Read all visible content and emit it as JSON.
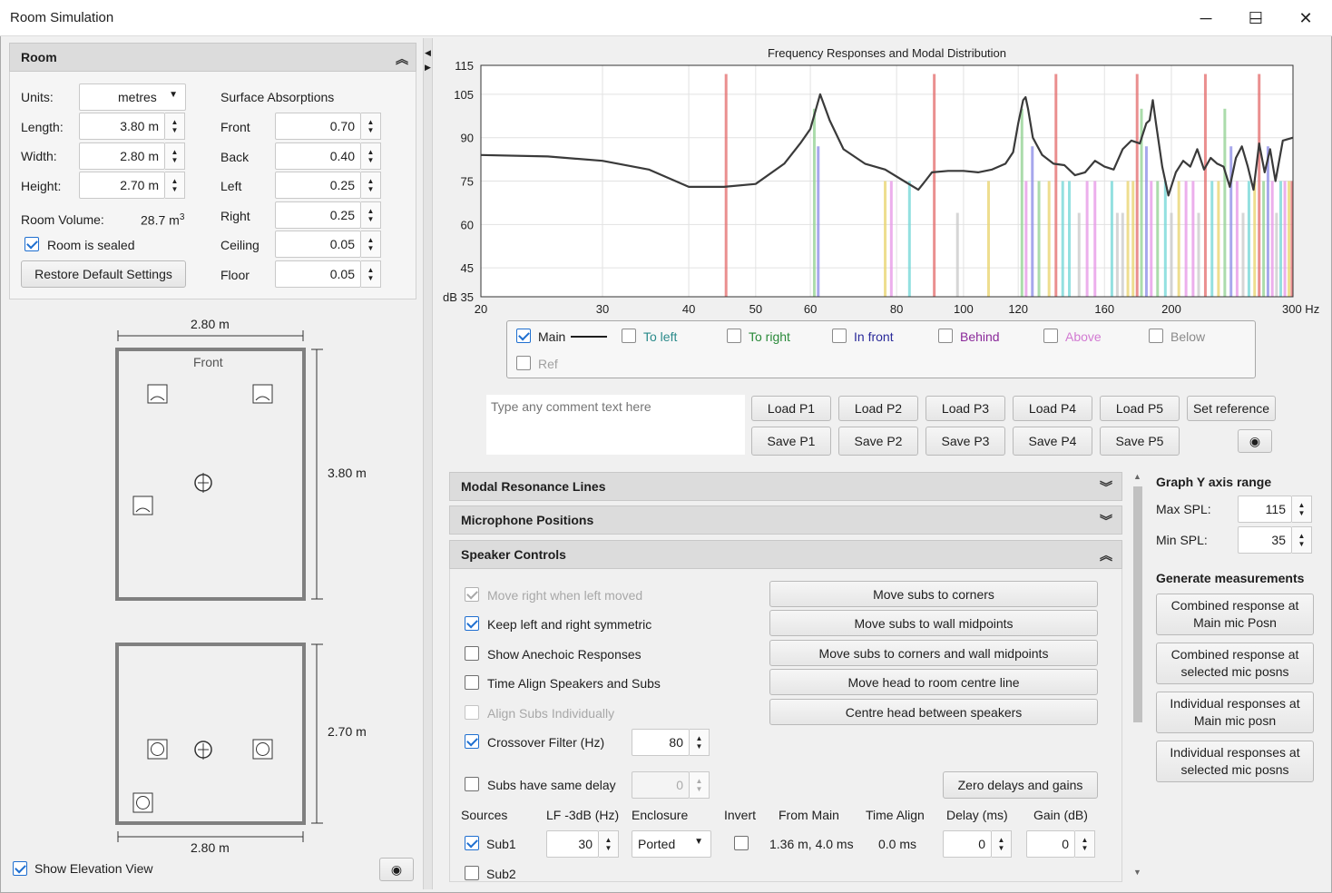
{
  "window": {
    "title": "Room Simulation",
    "minimize": "─",
    "maximize": "☐",
    "close": "✕"
  },
  "room": {
    "header": "Room",
    "units_label": "Units:",
    "units_value": "metres",
    "length_label": "Length:",
    "length_value": "3.80 m",
    "width_label": "Width:",
    "width_value": "2.80 m",
    "height_label": "Height:",
    "height_value": "2.70 m",
    "volume_label": "Room Volume:",
    "volume_value": "28.7 m",
    "volume_sup": "3",
    "sealed_label": "Room is sealed",
    "sealed": true,
    "restore_button": "Restore Default Settings",
    "absorptions_title": "Surface Absorptions",
    "surfaces": [
      {
        "label": "Front",
        "value": "0.70"
      },
      {
        "label": "Back",
        "value": "0.40"
      },
      {
        "label": "Left",
        "value": "0.25"
      },
      {
        "label": "Right",
        "value": "0.25"
      },
      {
        "label": "Ceiling",
        "value": "0.05"
      },
      {
        "label": "Floor",
        "value": "0.05"
      }
    ]
  },
  "plan_view": {
    "width_dim": "2.80 m",
    "length_dim": "3.80 m",
    "front_label": "Front"
  },
  "elevation_view": {
    "height_dim": "2.70 m",
    "width_dim": "2.80 m"
  },
  "show_elevation": {
    "label": "Show Elevation View",
    "checked": true
  },
  "chart_data": {
    "type": "line",
    "title": "Frequency Responses and Modal Distribution",
    "xscale": "log",
    "xlim": [
      20,
      300
    ],
    "ylim": [
      35,
      115
    ],
    "xticks": [
      "20",
      "30",
      "40",
      "50",
      "60",
      "80",
      "100",
      "120",
      "160",
      "200",
      "300 Hz"
    ],
    "xtick_values": [
      20,
      30,
      40,
      50,
      60,
      80,
      100,
      120,
      160,
      200,
      300
    ],
    "yticks": [
      "115",
      "105",
      "90",
      "75",
      "60",
      "45",
      "dB 35"
    ],
    "ytick_values": [
      115,
      105,
      90,
      75,
      60,
      45,
      35
    ],
    "grid": true,
    "series": [
      {
        "name": "Main",
        "color": "#3a3a3a",
        "x": [
          20,
          25,
          30,
          35,
          40,
          45,
          50,
          55,
          58,
          60,
          61,
          62,
          64,
          67,
          72,
          77,
          82,
          86,
          88,
          90,
          95,
          100,
          105,
          110,
          115,
          118,
          120,
          122,
          123,
          124,
          126,
          130,
          135,
          140,
          145,
          150,
          155,
          160,
          165,
          170,
          175,
          180,
          184,
          186,
          188,
          190,
          194,
          198,
          203,
          208,
          213,
          218,
          223,
          228,
          233,
          238,
          243,
          248,
          253,
          258,
          263,
          268,
          273,
          278,
          283,
          290,
          300
        ],
        "y": [
          84,
          83.5,
          82,
          79,
          73,
          73,
          74,
          81,
          88,
          93,
          99,
          105,
          96,
          86,
          81,
          79,
          75,
          72,
          75,
          78,
          78.5,
          78.5,
          78,
          79,
          81,
          85,
          95,
          103,
          104,
          100,
          90,
          84,
          81,
          80.5,
          77,
          78,
          82,
          80,
          79,
          86,
          89,
          88,
          95,
          96,
          103,
          95,
          80,
          70,
          78,
          82,
          80,
          86,
          79,
          83,
          81,
          80,
          73,
          83,
          87,
          80,
          72,
          88,
          78,
          86,
          75,
          89,
          90
        ]
      },
      {
        "name": "To left"
      },
      {
        "name": "To right"
      },
      {
        "name": "In front"
      },
      {
        "name": "Behind"
      },
      {
        "name": "Above"
      },
      {
        "name": "Below"
      },
      {
        "name": "Ref"
      }
    ],
    "modal_lines": [
      {
        "x": 45.3,
        "top": 112,
        "color": "#e36a6a"
      },
      {
        "x": 60.8,
        "top": 100,
        "color": "#8fd08f"
      },
      {
        "x": 61.6,
        "top": 87,
        "color": "#8a8ae6"
      },
      {
        "x": 77,
        "top": 75,
        "color": "#e8d36a"
      },
      {
        "x": 78.6,
        "top": 75,
        "color": "#e594e5"
      },
      {
        "x": 83.5,
        "top": 75,
        "color": "#6fd6d6"
      },
      {
        "x": 90.7,
        "top": 112,
        "color": "#e36a6a"
      },
      {
        "x": 98,
        "top": 64,
        "color": "#c8c8c8"
      },
      {
        "x": 108.7,
        "top": 75,
        "color": "#e8d36a"
      },
      {
        "x": 121.5,
        "top": 100,
        "color": "#8fd08f"
      },
      {
        "x": 123.2,
        "top": 75,
        "color": "#e594e5"
      },
      {
        "x": 125.8,
        "top": 87,
        "color": "#8a8ae6"
      },
      {
        "x": 128.6,
        "top": 75,
        "color": "#8fd08f"
      },
      {
        "x": 133,
        "top": 75,
        "color": "#e8d36a"
      },
      {
        "x": 136.1,
        "top": 112,
        "color": "#e36a6a"
      },
      {
        "x": 139.2,
        "top": 75,
        "color": "#6fd6d6"
      },
      {
        "x": 142.3,
        "top": 75,
        "color": "#6fd6d6"
      },
      {
        "x": 147,
        "top": 64,
        "color": "#c8c8c8"
      },
      {
        "x": 151,
        "top": 75,
        "color": "#e594e5"
      },
      {
        "x": 155,
        "top": 75,
        "color": "#e594e5"
      },
      {
        "x": 164,
        "top": 75,
        "color": "#6fd6d6"
      },
      {
        "x": 167,
        "top": 64,
        "color": "#c8c8c8"
      },
      {
        "x": 170,
        "top": 64,
        "color": "#c8c8c8"
      },
      {
        "x": 173,
        "top": 75,
        "color": "#e8d36a"
      },
      {
        "x": 176,
        "top": 75,
        "color": "#e8d36a"
      },
      {
        "x": 178.4,
        "top": 112,
        "color": "#e36a6a"
      },
      {
        "x": 181,
        "top": 100,
        "color": "#8fd08f"
      },
      {
        "x": 184,
        "top": 87,
        "color": "#8a8ae6"
      },
      {
        "x": 187,
        "top": 75,
        "color": "#e594e5"
      },
      {
        "x": 191,
        "top": 75,
        "color": "#8fd08f"
      },
      {
        "x": 196,
        "top": 75,
        "color": "#6fd6d6"
      },
      {
        "x": 200,
        "top": 64,
        "color": "#c8c8c8"
      },
      {
        "x": 205,
        "top": 75,
        "color": "#e8d36a"
      },
      {
        "x": 210,
        "top": 75,
        "color": "#e594e5"
      },
      {
        "x": 215,
        "top": 75,
        "color": "#e594e5"
      },
      {
        "x": 219,
        "top": 64,
        "color": "#c8c8c8"
      },
      {
        "x": 224,
        "top": 112,
        "color": "#e36a6a"
      },
      {
        "x": 229,
        "top": 75,
        "color": "#6fd6d6"
      },
      {
        "x": 234,
        "top": 75,
        "color": "#e8d36a"
      },
      {
        "x": 239,
        "top": 100,
        "color": "#8fd08f"
      },
      {
        "x": 244,
        "top": 87,
        "color": "#8a8ae6"
      },
      {
        "x": 249,
        "top": 75,
        "color": "#e594e5"
      },
      {
        "x": 254,
        "top": 64,
        "color": "#c8c8c8"
      },
      {
        "x": 259,
        "top": 75,
        "color": "#6fd6d6"
      },
      {
        "x": 264,
        "top": 75,
        "color": "#e8d36a"
      },
      {
        "x": 268,
        "top": 112,
        "color": "#e36a6a"
      },
      {
        "x": 272,
        "top": 75,
        "color": "#8fd08f"
      },
      {
        "x": 276,
        "top": 87,
        "color": "#8a8ae6"
      },
      {
        "x": 280,
        "top": 75,
        "color": "#e594e5"
      },
      {
        "x": 284,
        "top": 64,
        "color": "#c8c8c8"
      },
      {
        "x": 288,
        "top": 75,
        "color": "#6fd6d6"
      },
      {
        "x": 292,
        "top": 75,
        "color": "#e594e5"
      },
      {
        "x": 296,
        "top": 75,
        "color": "#e8d36a"
      },
      {
        "x": 299,
        "top": 75,
        "color": "#e36a6a"
      }
    ]
  },
  "legend": {
    "items": [
      {
        "label": "Main",
        "checked": true,
        "color": "#1e1e1e"
      },
      {
        "label": "To left",
        "checked": false,
        "color": "#2a8a8a"
      },
      {
        "label": "To right",
        "checked": false,
        "color": "#2a8a3a"
      },
      {
        "label": "In front",
        "checked": false,
        "color": "#2a2a9a"
      },
      {
        "label": "Behind",
        "checked": false,
        "color": "#8a2a9a"
      },
      {
        "label": "Above",
        "checked": false,
        "color": "#d27ad2"
      },
      {
        "label": "Below",
        "checked": false,
        "color": "#8a8a8a"
      },
      {
        "label": "Ref",
        "checked": false,
        "color": "#a0a0a0"
      }
    ]
  },
  "comment": {
    "placeholder": "Type any comment text here"
  },
  "presets": {
    "load": [
      "Load P1",
      "Load P2",
      "Load P3",
      "Load P4",
      "Load P5"
    ],
    "save": [
      "Save P1",
      "Save P2",
      "Save P3",
      "Save P4",
      "Save P5"
    ],
    "set_reference": "Set reference"
  },
  "sections": {
    "modal": "Modal Resonance Lines",
    "mic": "Microphone Positions",
    "speaker": "Speaker Controls"
  },
  "speaker": {
    "checks": [
      {
        "label": "Move right when left moved",
        "checked": true,
        "disabled": true
      },
      {
        "label": "Keep left and right symmetric",
        "checked": true,
        "disabled": false
      },
      {
        "label": "Show Anechoic Responses",
        "checked": false,
        "disabled": false
      },
      {
        "label": "Time Align Speakers and Subs",
        "checked": false,
        "disabled": false
      },
      {
        "label": "Align Subs Individually",
        "checked": false,
        "disabled": true
      },
      {
        "label": "Crossover Filter (Hz)",
        "checked": true,
        "disabled": false
      }
    ],
    "crossover_value": "80",
    "buttons": [
      "Move subs to corners",
      "Move subs to wall midpoints",
      "Move subs to corners and wall midpoints",
      "Move head to room centre line",
      "Centre head between speakers"
    ],
    "same_delay_label": "Subs have same delay",
    "same_delay_value": "0",
    "zero_button": "Zero delays and gains",
    "columns": [
      "Sources",
      "LF -3dB (Hz)",
      "Enclosure",
      "Invert",
      "From Main",
      "Time Align",
      "Delay (ms)",
      "Gain (dB)"
    ],
    "rows": [
      {
        "name": "Sub1",
        "checked": true,
        "lf": "30",
        "enclosure": "Ported",
        "invert": false,
        "from_main": "1.36 m, 4.0 ms",
        "time_align": "0.0 ms",
        "delay": "0",
        "gain": "0"
      },
      {
        "name": "Sub2",
        "checked": false
      }
    ]
  },
  "graph_range": {
    "title": "Graph Y axis range",
    "max_label": "Max SPL:",
    "max_value": "115",
    "min_label": "Min SPL:",
    "min_value": "35"
  },
  "measurements": {
    "title": "Generate measurements",
    "buttons": [
      {
        "line1": "Combined response at",
        "line2": "Main mic Posn"
      },
      {
        "line1": "Combined response at",
        "line2": "selected mic posns"
      },
      {
        "line1": "Individual responses at",
        "line2": "Main mic posn"
      },
      {
        "line1": "Individual responses at",
        "line2": "selected mic posns"
      }
    ]
  }
}
